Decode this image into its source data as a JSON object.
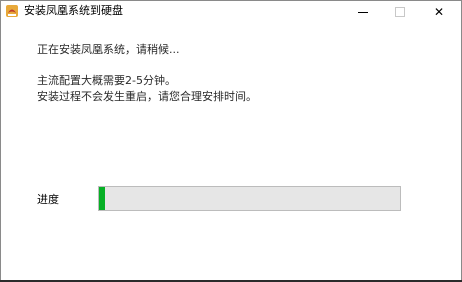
{
  "window": {
    "title": "安装凤凰系统到硬盘",
    "icon": "phoenix-app-icon",
    "controls": {
      "minimize_icon": "minimize-icon",
      "maximize_icon": "maximize-icon",
      "close_icon": "close-icon",
      "close_glyph": "✕"
    }
  },
  "body": {
    "status_line": "正在安装凤凰系统，请稍候...",
    "info_line1": "主流配置大概需要2-5分钟。",
    "info_line2": "安装过程不会发生重启，请您合理安排时间。"
  },
  "progress": {
    "label": "进度",
    "value_fraction": 0.02,
    "fill_color": "#06b025"
  }
}
